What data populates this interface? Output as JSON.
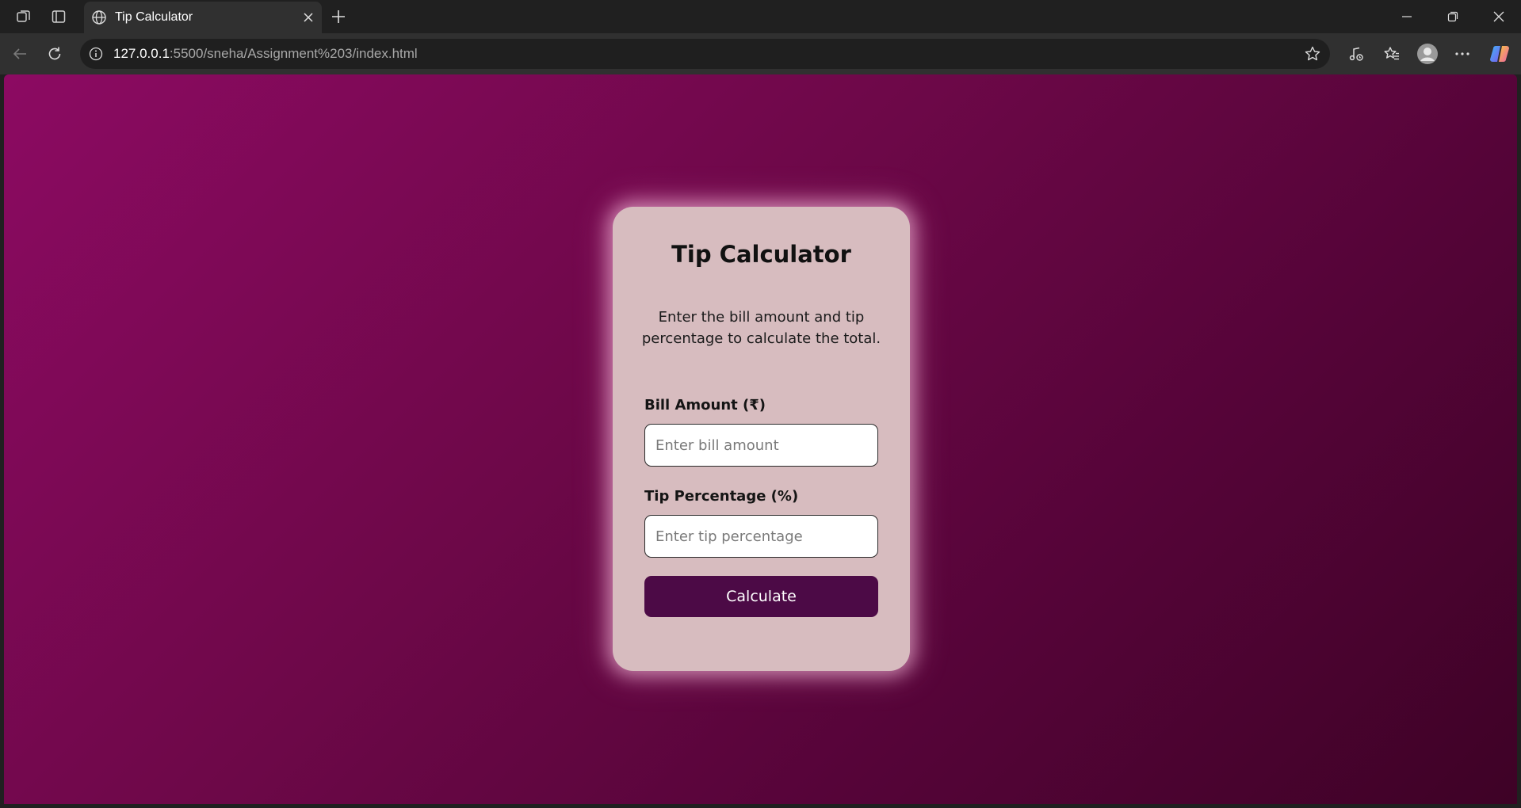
{
  "browser": {
    "tab": {
      "title": "Tip Calculator"
    },
    "address_bar": {
      "host": "127.0.0.1",
      "path": ":5500/sneha/Assignment%203/index.html"
    },
    "icons": {
      "workspaces": "workspaces-icon",
      "tab_actions": "tab-actions-icon",
      "favicon": "globe-icon",
      "close_tab": "close-icon",
      "new_tab": "plus-icon",
      "back": "back-arrow-icon",
      "refresh": "refresh-icon",
      "site_info": "info-icon",
      "favorite": "star-icon",
      "media": "media-control-icon",
      "favorites": "favorites-icon",
      "profile": "profile-icon",
      "more": "more-icon",
      "copilot": "copilot-icon"
    }
  },
  "app": {
    "title": "Tip Calculator",
    "description": "Enter the bill amount and tip percentage to calculate the total.",
    "bill": {
      "label": "Bill Amount (₹)",
      "placeholder": "Enter bill amount",
      "value": ""
    },
    "tip": {
      "label": "Tip Percentage (%)",
      "placeholder": "Enter tip percentage",
      "value": ""
    },
    "calculate_label": "Calculate"
  },
  "colors": {
    "background_start": "#8c0a62",
    "background_end": "#3e0226",
    "card": "#d7bcbf",
    "button": "#4c0a46"
  }
}
